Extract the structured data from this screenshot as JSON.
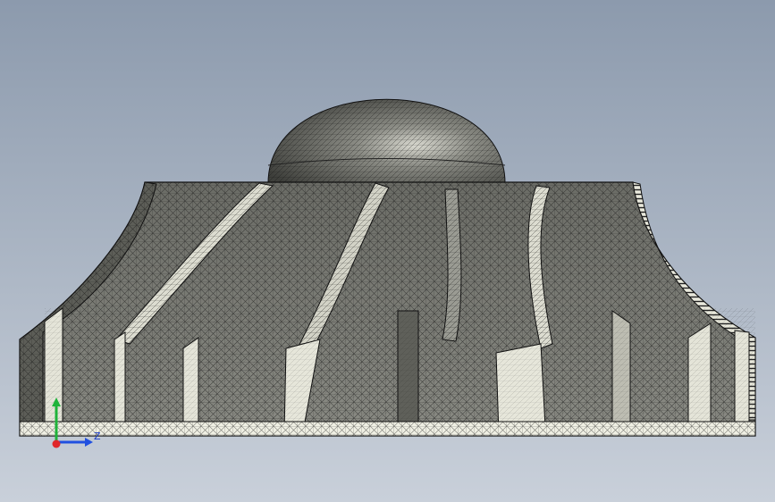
{
  "viewport": {
    "background_top": "#8c9aad",
    "background_bottom": "#c9d0da"
  },
  "model": {
    "render_style": "shaded-with-mesh-edges",
    "surface_color": "#6f7069",
    "edge_color": "#000000",
    "highlight_color": "#ecece2"
  },
  "triad": {
    "axis_z_label": "Z",
    "colors": {
      "x": "#e0262a",
      "y": "#1fb33a",
      "z": "#2050e0"
    }
  }
}
